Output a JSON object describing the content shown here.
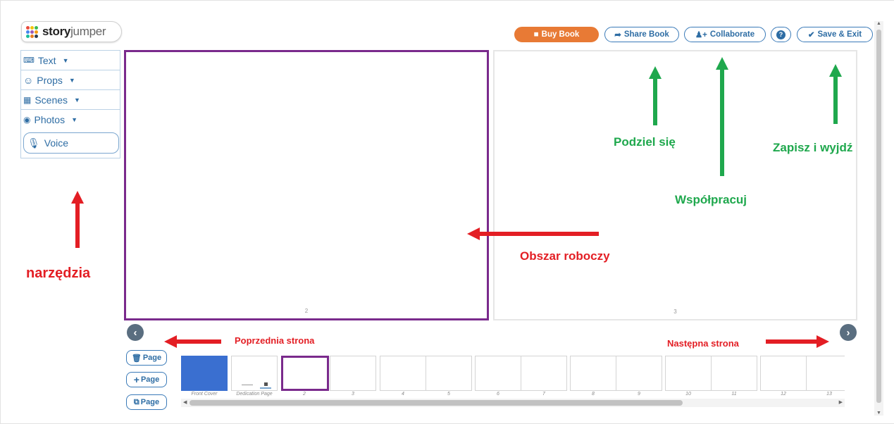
{
  "logo": {
    "text_bold": "story",
    "text_light": "jumper",
    "dot_colors": [
      "#e94b3c",
      "#f4c20d",
      "#3cba54",
      "#4885ed",
      "#9b59b6",
      "#f39c12",
      "#1abc9c",
      "#e67e22",
      "#2c3e50"
    ]
  },
  "toolbar": {
    "buy_label": "Buy Book",
    "share_label": "Share Book",
    "collaborate_label": "Collaborate",
    "help_label": "?",
    "save_label": "Save & Exit"
  },
  "tools": {
    "text_label": "Text",
    "props_label": "Props",
    "scenes_label": "Scenes",
    "photos_label": "Photos",
    "voice_label": "Voice"
  },
  "pages": {
    "left_number": "2",
    "right_number": "3"
  },
  "page_buttons": {
    "delete_label": "Page",
    "add_label": "Page",
    "duplicate_label": "Page"
  },
  "thumbnails": [
    "Front Cover",
    "Dedication Page",
    "2",
    "3",
    "4",
    "5",
    "6",
    "7",
    "8",
    "9",
    "10",
    "11",
    "12",
    "13"
  ],
  "annotations": {
    "share": "Podziel się",
    "save": "Zapisz i wyjdź",
    "collaborate": "Współpracuj",
    "workspace": "Obszar roboczy",
    "tools": "narzędzia",
    "prev": "Poprzednia strona",
    "next": "Następna strona"
  },
  "colors": {
    "accent": "#e87a35",
    "link": "#2e6da4",
    "selected_page": "#7a2a8c",
    "annotation_green": "#1fa84d",
    "annotation_red": "#e31e24"
  }
}
